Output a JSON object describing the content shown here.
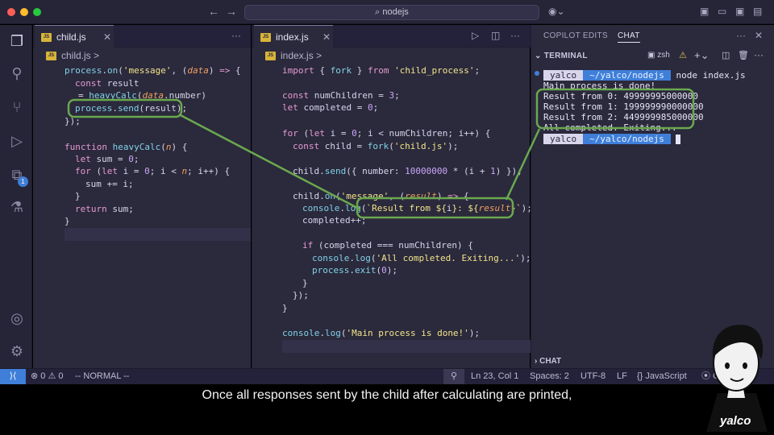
{
  "titlebar": {
    "search_text": "nodejs"
  },
  "activity": {
    "extensions_badge": "1"
  },
  "left_editor": {
    "tab_label": "child.js",
    "breadcrumb": "child.js >",
    "more": "···"
  },
  "middle_editor": {
    "tab_label": "index.js",
    "breadcrumb": "index.js >",
    "more": "···"
  },
  "side": {
    "tab_copilot": "COPILOT EDITS",
    "tab_chat": "CHAT",
    "terminal_header": "TERMINAL",
    "shell_name": "zsh",
    "bottom_chat_header": "CHAT",
    "prompt_user": "yalco",
    "prompt_dir": "~/yalco/nodejs",
    "command": "node index.js",
    "outputs": [
      "Main process is done!",
      "Result from 0: 49999995000000",
      "Result from 1: 199999990000000",
      "Result from 2: 449999985000000",
      "All completed. Exiting..."
    ],
    "prompt2_user": "yalco",
    "prompt2_dir": "~/yalco/nodejs"
  },
  "status": {
    "errors": "0",
    "warnings": "0",
    "mode": "-- NORMAL --",
    "position": "Ln 23, Col 1",
    "spaces": "Spaces: 2",
    "encoding": "UTF-8",
    "eol": "LF",
    "language": "JavaScript",
    "extra": "Go"
  },
  "subtitle": "Once all responses sent by the child after calculating are printed,",
  "logo": "yalco",
  "colors": {
    "highlight_green": "#6aa84f",
    "accent_blue": "#3f7fd9",
    "editor_bg": "#2b293c"
  }
}
